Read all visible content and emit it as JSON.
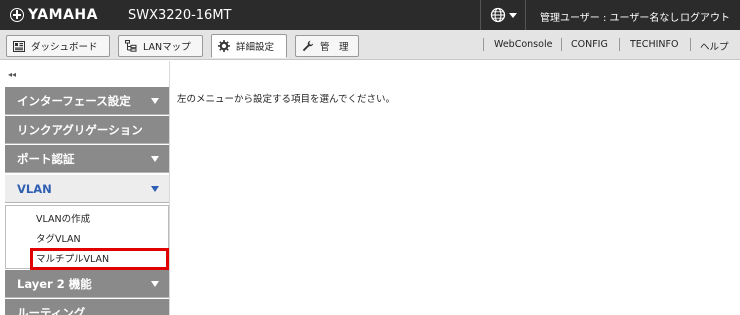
{
  "header": {
    "brand": "YAMAHA",
    "model": "SWX3220-16MT",
    "user_info": "管理ユーザー : ユーザー名なし",
    "logout": "ログアウト"
  },
  "toolbar": {
    "tabs": [
      {
        "label": "ダッシュボード",
        "icon": "dashboard-icon"
      },
      {
        "label": "LANマップ",
        "icon": "lan-map-icon"
      },
      {
        "label": "詳細設定",
        "icon": "gear-icon",
        "active": true
      },
      {
        "label": "管　理",
        "icon": "wrench-icon"
      }
    ],
    "links": [
      "WebConsole",
      "CONFIG",
      "TECHINFO",
      "ヘルプ"
    ]
  },
  "sidebar": {
    "collapse_label": "◂◂",
    "items": [
      {
        "label": "インターフェース設定",
        "has_arrow": true
      },
      {
        "label": "リンクアグリゲーション",
        "has_arrow": false
      },
      {
        "label": "ポート認証",
        "has_arrow": true
      },
      {
        "label": "VLAN",
        "has_arrow": true,
        "expanded": true
      },
      {
        "label": "Layer 2 機能",
        "has_arrow": true
      },
      {
        "label": "ルーティング",
        "has_arrow": false
      }
    ],
    "vlan_submenu": [
      "VLANの作成",
      "タグVLAN",
      "マルチプルVLAN"
    ],
    "highlighted_item": "マルチプルVLAN"
  },
  "main": {
    "message": "左のメニューから設定する項目を選んでください。"
  },
  "colors": {
    "header_bg": "#2b2b2b",
    "menu_bg": "#8a8a8a",
    "active_menu_text": "#2f5fb3",
    "highlight": "#e00000"
  }
}
